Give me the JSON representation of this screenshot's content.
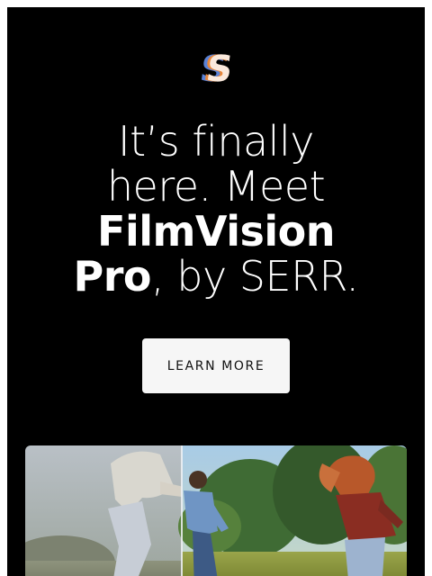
{
  "brand": {
    "logo_icon": "serr-s-logo-icon",
    "colors": {
      "background": "#000000",
      "text": "#ffffff",
      "button_bg": "#f6f6f6",
      "button_text": "#111111",
      "logo_orange": "#e8873a",
      "logo_blue": "#5a82d6",
      "logo_cream": "#fbe9dc"
    }
  },
  "headline": {
    "line1": "It’s finally",
    "line2": "here. Meet",
    "product_name_1": "FilmVision",
    "product_name_2": "Pro",
    "suffix": ", by SERR."
  },
  "cta": {
    "label": "LEARN MORE"
  },
  "hero_image": {
    "icon": "split-comparison-photo",
    "description_icon": "people-running-field-image"
  }
}
